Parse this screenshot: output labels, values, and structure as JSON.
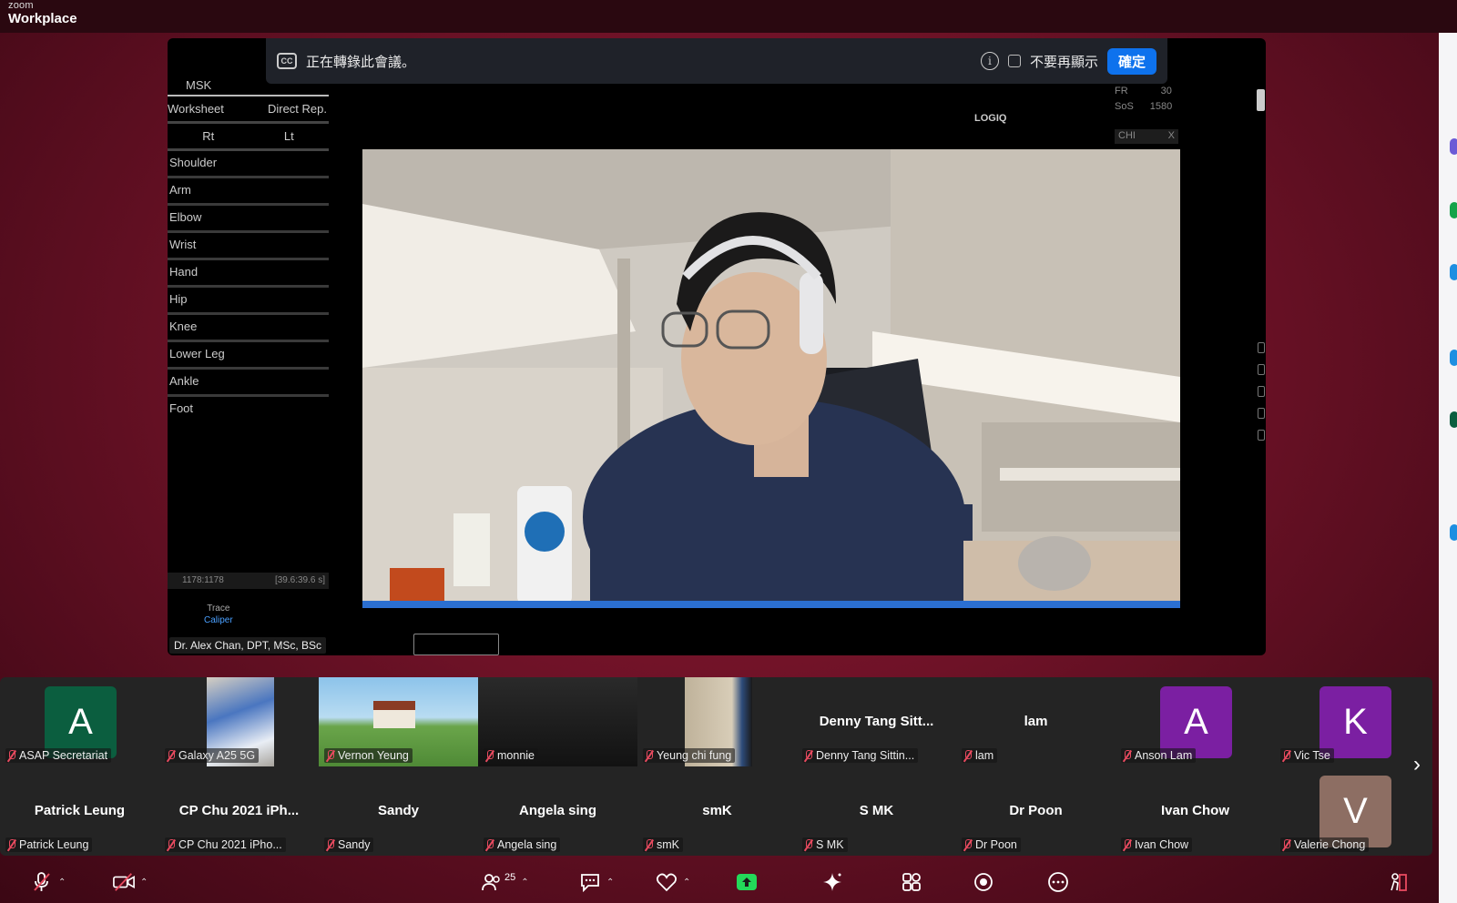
{
  "app": {
    "brand_small": "zoom",
    "brand_big": "Workplace"
  },
  "caption_banner": {
    "text": "正在轉錄此會議。",
    "dont_show_label": "不要再顯示",
    "ok_label": "確定"
  },
  "shared_screen": {
    "menu_header": "MSK",
    "worksheet": "Worksheet",
    "direct_rep": "Direct Rep.",
    "rt": "Rt",
    "lt": "Lt",
    "items": [
      "Shoulder",
      "Arm",
      "Elbow",
      "Wrist",
      "Hand",
      "Hip",
      "Knee",
      "Lower Leg",
      "Ankle",
      "Foot"
    ],
    "counter_left": "1178:1178",
    "counter_right": "[39.6:39.6 s]",
    "trace": "Trace",
    "caliper": "Caliper",
    "logo": "LOGIQ",
    "fr_label": "FR",
    "fr_value": "30",
    "sos_label": "SoS",
    "sos_value": "1580",
    "chi_label": "CHI",
    "chi_x": "X",
    "speaker_name": "Dr. Alex Chan, DPT, MSc, BSc"
  },
  "participants_row1": [
    {
      "label": "ASAP Secretariat",
      "type": "avatar",
      "letter": "A",
      "color": "#0b5e3f"
    },
    {
      "label": "Galaxy A25 5G",
      "type": "video"
    },
    {
      "label": "Vernon Yeung",
      "type": "video"
    },
    {
      "label": "monnie",
      "type": "video"
    },
    {
      "label": "Yeung chi fung",
      "type": "video"
    },
    {
      "label": "Denny Tang Sittin...",
      "type": "name",
      "big": "Denny Tang Sitt..."
    },
    {
      "label": "lam",
      "type": "name",
      "big": "lam"
    },
    {
      "label": "Anson Lam",
      "type": "avatar",
      "letter": "A",
      "color": "#7b1fa2"
    },
    {
      "label": "Vic Tse",
      "type": "avatar",
      "letter": "K",
      "color": "#7b1fa2"
    }
  ],
  "participants_row2": [
    {
      "label": "Patrick Leung",
      "big": "Patrick Leung"
    },
    {
      "label": "CP Chu 2021 iPho...",
      "big": "CP Chu 2021 iPh..."
    },
    {
      "label": "Sandy",
      "big": "Sandy"
    },
    {
      "label": "Angela sing",
      "big": "Angela sing"
    },
    {
      "label": "smK",
      "big": "smK"
    },
    {
      "label": "S MK",
      "big": "S MK"
    },
    {
      "label": "Dr Poon",
      "big": "Dr Poon"
    },
    {
      "label": "Ivan Chow",
      "big": "Ivan Chow"
    },
    {
      "label": "Valerie Chong",
      "letter": "V",
      "color": "#8d6e63"
    }
  ],
  "toolbar": {
    "participants_count": "25"
  },
  "colors": {
    "accent": "#0e72ed",
    "share_green": "#23d959",
    "mute_red": "#e84a5f"
  }
}
